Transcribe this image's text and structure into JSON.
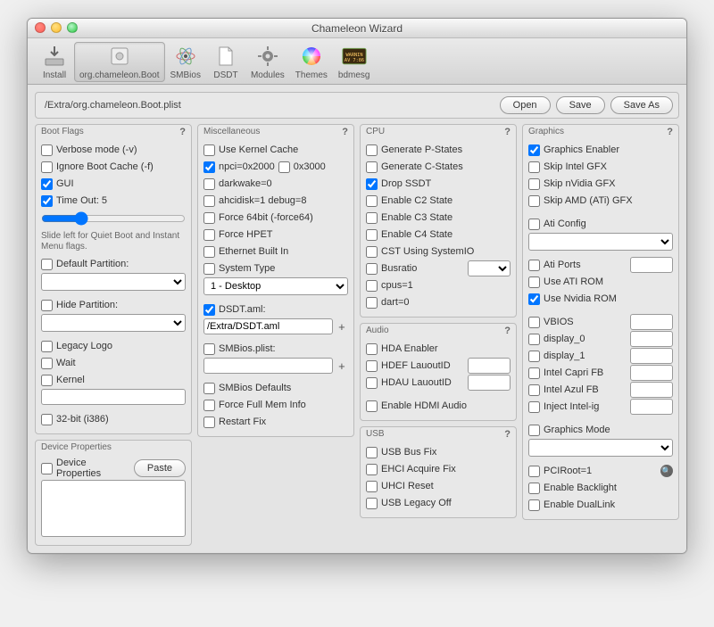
{
  "window": {
    "title": "Chameleon Wizard"
  },
  "toolbar": {
    "items": [
      {
        "label": "Install"
      },
      {
        "label": "org.chameleon.Boot"
      },
      {
        "label": "SMBios"
      },
      {
        "label": "DSDT"
      },
      {
        "label": "Modules"
      },
      {
        "label": "Themes"
      },
      {
        "label": "bdmesg"
      }
    ]
  },
  "pathbar": {
    "path": "/Extra/org.chameleon.Boot.plist",
    "open": "Open",
    "save": "Save",
    "saveas": "Save As"
  },
  "bootflags": {
    "title": "Boot Flags",
    "verbose": "Verbose mode (-v)",
    "ignorecache": "Ignore Boot Cache (-f)",
    "gui": "GUI",
    "timeout": "Time Out: 5",
    "hint": "Slide left for Quiet Boot and Instant Menu flags.",
    "defpart": "Default Partition:",
    "hidepart": "Hide Partition:",
    "legacy": "Legacy Logo",
    "wait": "Wait",
    "kernel": "Kernel",
    "i386": "32-bit (i386)"
  },
  "misc": {
    "title": "Miscellaneous",
    "usekernelcache": "Use Kernel Cache",
    "npci2000": "npci=0x2000",
    "npci3000": "0x3000",
    "darkwake": "darkwake=0",
    "ahcidisk": "ahcidisk=1 debug=8",
    "force64": "Force 64bit (-force64)",
    "forcehpet": "Force HPET",
    "eth": "Ethernet Built In",
    "systype": "System Type",
    "systype_sel": "1 - Desktop",
    "dsdtaml": "DSDT.aml:",
    "dsdtpath": "/Extra/DSDT.aml",
    "smbiosplist": "SMBios.plist:",
    "smbiosdefaults": "SMBios Defaults",
    "forcefullmem": "Force Full Mem Info",
    "restartfix": "Restart Fix"
  },
  "cpu": {
    "title": "CPU",
    "genp": "Generate P-States",
    "genc": "Generate C-States",
    "dropssdt": "Drop SSDT",
    "c2": "Enable C2 State",
    "c3": "Enable C3 State",
    "c4": "Enable C4 State",
    "cstsys": "CST Using SystemIO",
    "busratio": "Busratio",
    "cpus1": "cpus=1",
    "dart": "dart=0"
  },
  "audio": {
    "title": "Audio",
    "hdaenabler": "HDA Enabler",
    "hdef": "HDEF LauoutID",
    "hdau": "HDAU LauoutID",
    "hdmi": "Enable HDMI Audio"
  },
  "usb": {
    "title": "USB",
    "busfix": "USB Bus Fix",
    "ehci": "EHCI Acquire Fix",
    "uhci": "UHCI Reset",
    "legacy": "USB Legacy Off"
  },
  "gfx": {
    "title": "Graphics",
    "enabler": "Graphics Enabler",
    "skipintel": "Skip Intel GFX",
    "skipnv": "Skip nVidia GFX",
    "skipamd": "Skip AMD (ATi) GFX",
    "aticonfig": "Ati Config",
    "atiports": "Ati Ports",
    "useatirom": "Use ATI ROM",
    "usenvrom": "Use Nvidia ROM",
    "vbios": "VBIOS",
    "d0": "display_0",
    "d1": "display_1",
    "capri": "Intel Capri FB",
    "azul": "Intel Azul FB",
    "injectig": "Inject Intel-ig",
    "gmode": "Graphics Mode",
    "pciroot": "PCIRoot=1",
    "backlight": "Enable Backlight",
    "duallink": "Enable DualLink"
  },
  "devprops": {
    "title": "Device Properties",
    "label": "Device Properties",
    "paste": "Paste"
  }
}
